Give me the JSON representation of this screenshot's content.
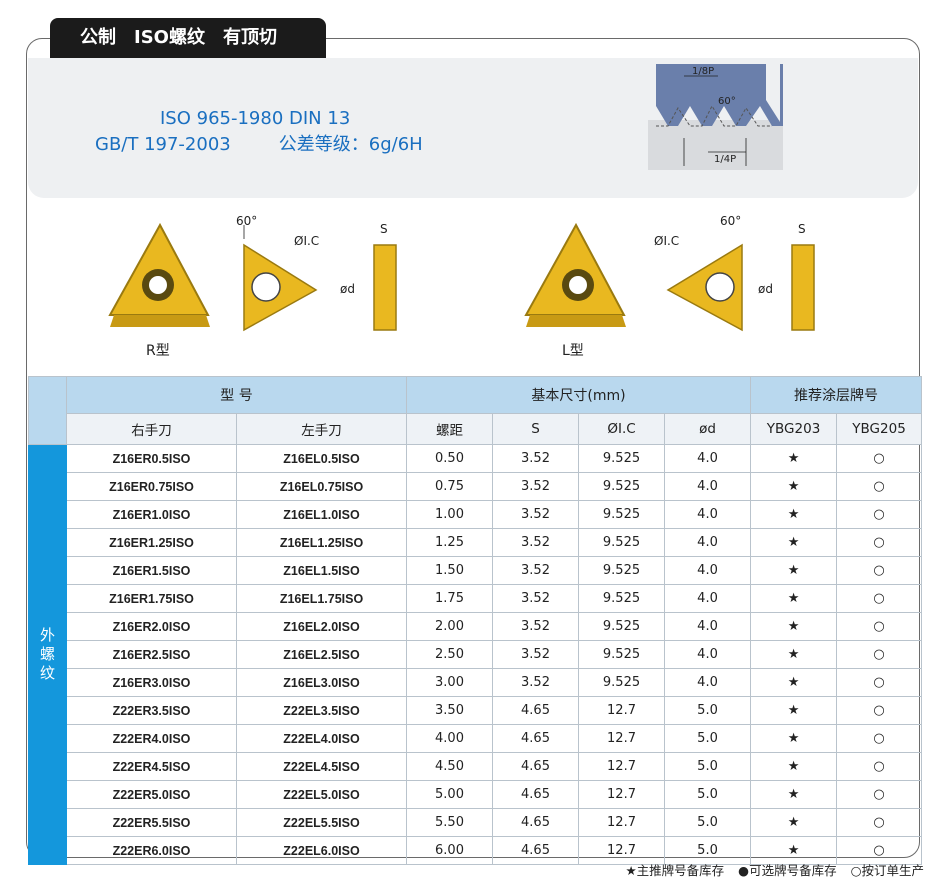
{
  "title": "公制　ISO螺纹　有顶切",
  "standards": {
    "line1": "ISO 965-1980   DIN 13",
    "line2_a": "GB/T 197-2003",
    "line2_b": "公差等级：6g/6H"
  },
  "thread_diagram": {
    "top_label": "1/8P",
    "angle_label": "60°",
    "bottom_label": "1/4P"
  },
  "inserts": {
    "r_label": "R型",
    "l_label": "L型",
    "angle": "60°",
    "ic": "ØI.C",
    "s": "S",
    "d": "ød"
  },
  "table": {
    "group_model": "型 号",
    "group_dims": "基本尺寸(mm)",
    "group_grade": "推荐涂层牌号",
    "columns": [
      "右手刀",
      "左手刀",
      "螺距",
      "S",
      "ØI.C",
      "ød",
      "YBG203",
      "YBG205"
    ],
    "side_label": "外螺纹",
    "rows": [
      [
        "Z16ER0.5ISO",
        "Z16EL0.5ISO",
        "0.50",
        "3.52",
        "9.525",
        "4.0",
        "★",
        "○"
      ],
      [
        "Z16ER0.75ISO",
        "Z16EL0.75ISO",
        "0.75",
        "3.52",
        "9.525",
        "4.0",
        "★",
        "○"
      ],
      [
        "Z16ER1.0ISO",
        "Z16EL1.0ISO",
        "1.00",
        "3.52",
        "9.525",
        "4.0",
        "★",
        "○"
      ],
      [
        "Z16ER1.25ISO",
        "Z16EL1.25ISO",
        "1.25",
        "3.52",
        "9.525",
        "4.0",
        "★",
        "○"
      ],
      [
        "Z16ER1.5ISO",
        "Z16EL1.5ISO",
        "1.50",
        "3.52",
        "9.525",
        "4.0",
        "★",
        "○"
      ],
      [
        "Z16ER1.75ISO",
        "Z16EL1.75ISO",
        "1.75",
        "3.52",
        "9.525",
        "4.0",
        "★",
        "○"
      ],
      [
        "Z16ER2.0ISO",
        "Z16EL2.0ISO",
        "2.00",
        "3.52",
        "9.525",
        "4.0",
        "★",
        "○"
      ],
      [
        "Z16ER2.5ISO",
        "Z16EL2.5ISO",
        "2.50",
        "3.52",
        "9.525",
        "4.0",
        "★",
        "○"
      ],
      [
        "Z16ER3.0ISO",
        "Z16EL3.0ISO",
        "3.00",
        "3.52",
        "9.525",
        "4.0",
        "★",
        "○"
      ],
      [
        "Z22ER3.5ISO",
        "Z22EL3.5ISO",
        "3.50",
        "4.65",
        "12.7",
        "5.0",
        "★",
        "○"
      ],
      [
        "Z22ER4.0ISO",
        "Z22EL4.0ISO",
        "4.00",
        "4.65",
        "12.7",
        "5.0",
        "★",
        "○"
      ],
      [
        "Z22ER4.5ISO",
        "Z22EL4.5ISO",
        "4.50",
        "4.65",
        "12.7",
        "5.0",
        "★",
        "○"
      ],
      [
        "Z22ER5.0ISO",
        "Z22EL5.0ISO",
        "5.00",
        "4.65",
        "12.7",
        "5.0",
        "★",
        "○"
      ],
      [
        "Z22ER5.5ISO",
        "Z22EL5.5ISO",
        "5.50",
        "4.65",
        "12.7",
        "5.0",
        "★",
        "○"
      ],
      [
        "Z22ER6.0ISO",
        "Z22EL6.0ISO",
        "6.00",
        "4.65",
        "12.7",
        "5.0",
        "★",
        "○"
      ]
    ]
  },
  "legend": {
    "star": "★主推牌号备库存",
    "dot": "●可选牌号备库存",
    "circle": "○按订单生产"
  },
  "colors": {
    "accent_blue": "#1497dc",
    "header_blue": "#b9d8ee",
    "standards_text": "#1a6fc0",
    "insert_gold": "#e9b820"
  }
}
